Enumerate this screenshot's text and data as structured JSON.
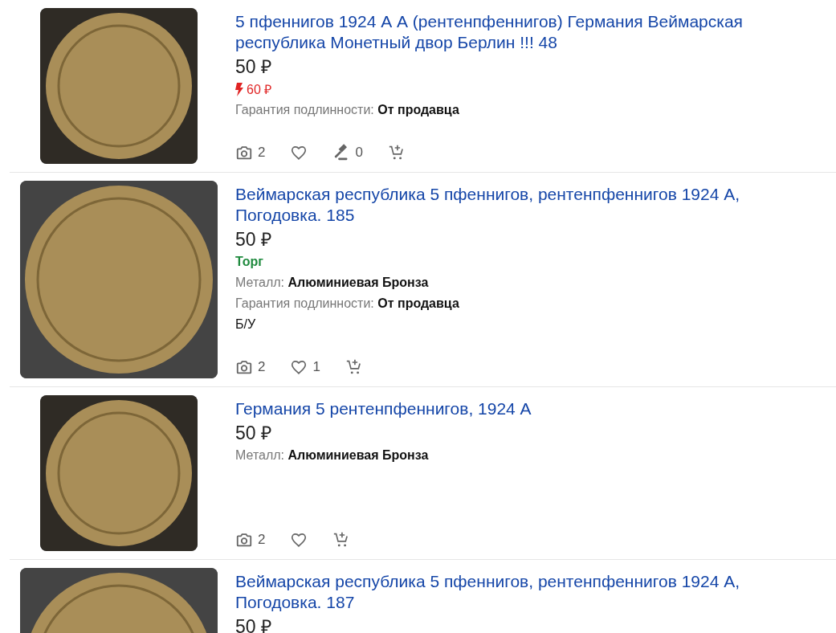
{
  "lots": [
    {
      "kind": "square",
      "title": "5 пфеннигов 1924 А А (рентенпфеннигов) Германия Веймарская республика Монетный двор Берлин !!! 48",
      "price": "50 ₽",
      "blitz_price": "60 ₽",
      "attributes": [
        {
          "label": "Гарантия подлинности:",
          "value": "От продавца"
        }
      ],
      "stats": [
        {
          "kind": "photos",
          "count": "2"
        },
        {
          "kind": "likes"
        },
        {
          "kind": "bids",
          "count": "0"
        },
        {
          "kind": "cart"
        }
      ]
    },
    {
      "kind": "wide",
      "title": "Веймарская республика 5 пфеннигов, рентенпфеннигов 1924 А, Погодовка. 185",
      "price": "50 ₽",
      "bargain": "Торг",
      "attributes": [
        {
          "label": "Металл:",
          "value": "Алюминиевая Бронза"
        },
        {
          "label": "Гарантия подлинности:",
          "value": "От продавца"
        }
      ],
      "condition": "Б/У",
      "stats": [
        {
          "kind": "photos",
          "count": "2"
        },
        {
          "kind": "likes",
          "count": "1"
        },
        {
          "kind": "cart"
        }
      ]
    },
    {
      "kind": "square",
      "title": "Германия 5 рентенпфеннигов, 1924 А",
      "price": "50 ₽",
      "attributes": [
        {
          "label": "Металл:",
          "value": "Алюминиевая Бронза"
        }
      ],
      "stats": [
        {
          "kind": "photos",
          "count": "2"
        },
        {
          "kind": "likes"
        },
        {
          "kind": "cart"
        }
      ]
    },
    {
      "kind": "wide",
      "title": "Веймарская республика 5 пфеннигов, рентенпфеннигов 1924 А, Погодовка. 187",
      "price": "50 ₽"
    }
  ]
}
